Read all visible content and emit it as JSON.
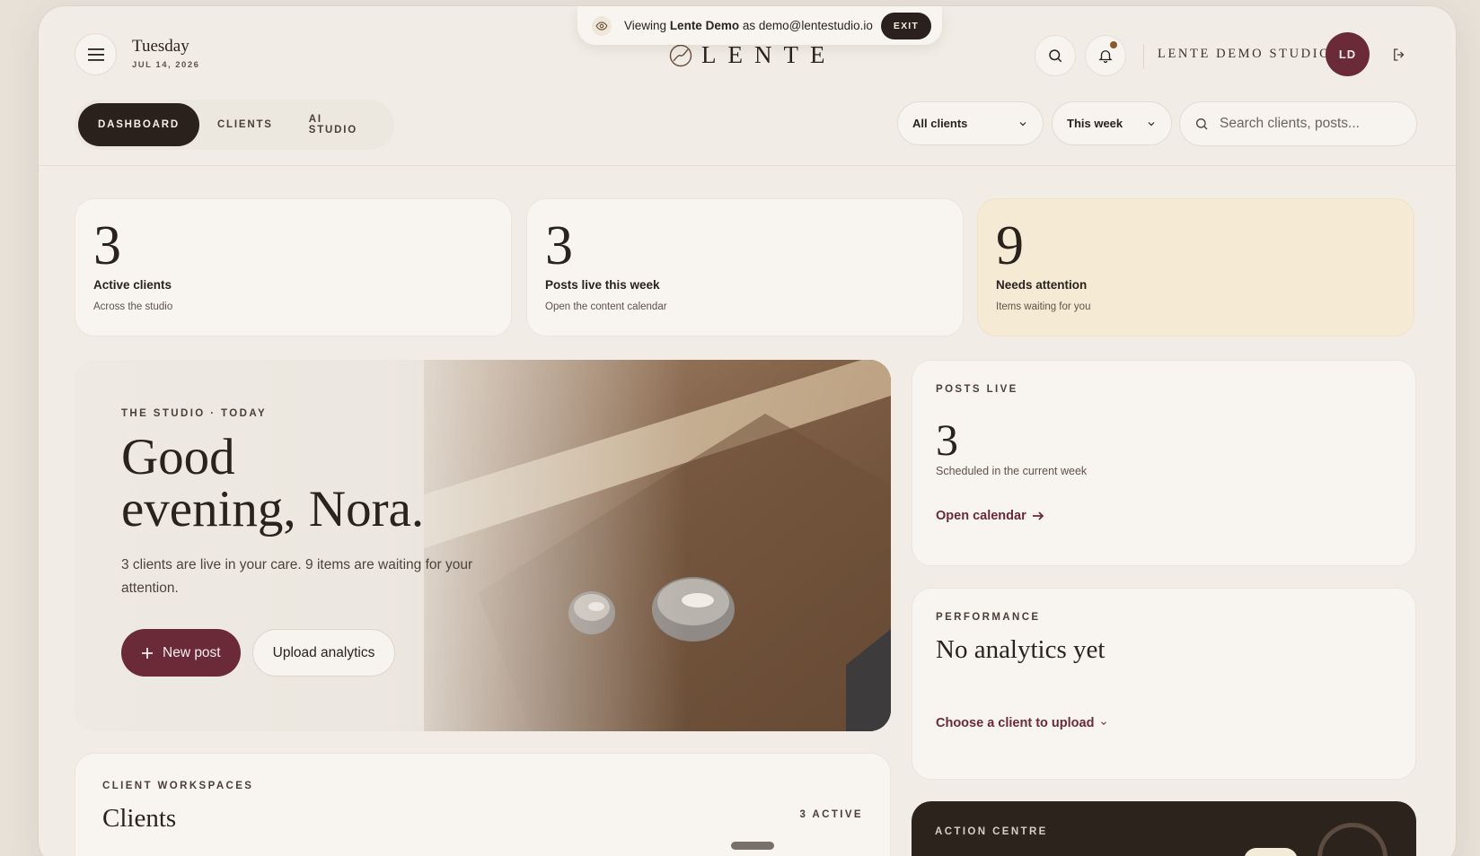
{
  "banner": {
    "prefix": "Viewing",
    "workspace": "Lente Demo",
    "middle": "as",
    "email": "demo@lentestudio.io",
    "exit_label": "EXIT"
  },
  "header": {
    "weekday": "Tuesday",
    "date": "JUL 14, 2026",
    "logo_text": "LENTE",
    "studio_name": "LENTE DEMO STUDIO",
    "avatar_initials": "LD"
  },
  "nav": {
    "tabs": [
      {
        "label": "DASHBOARD",
        "active": true
      },
      {
        "label": "CLIENTS",
        "active": false
      },
      {
        "label": "AI STUDIO",
        "active": false
      }
    ]
  },
  "filters": {
    "clients": "All clients",
    "period": "This week",
    "search_placeholder": "Search clients, posts..."
  },
  "stats": [
    {
      "value": "3",
      "label": "Active clients",
      "sub": "Across the studio"
    },
    {
      "value": "3",
      "label": "Posts live this week",
      "sub": "Open the content calendar"
    },
    {
      "value": "9",
      "label": "Needs attention",
      "sub": "Items waiting for you"
    }
  ],
  "hero": {
    "eyebrow": "THE STUDIO · TODAY",
    "title_line1": "Good",
    "title_line2": "evening, Nora.",
    "subtitle": "3 clients are live in your care. 9 items are waiting for your attention.",
    "primary_label": "New post",
    "secondary_label": "Upload analytics"
  },
  "posts_live": {
    "eyebrow": "POSTS LIVE",
    "value": "3",
    "sub": "Scheduled in the current week",
    "link": "Open calendar"
  },
  "performance": {
    "eyebrow": "PERFORMANCE",
    "title": "No analytics yet",
    "link": "Choose a client to upload"
  },
  "action_centre": {
    "eyebrow": "ACTION CENTRE"
  },
  "clients": {
    "eyebrow": "CLIENT WORKSPACES",
    "title": "Clients",
    "count": "3 ACTIVE"
  },
  "colors": {
    "accent": "#6a2a37",
    "dark": "#2b211c",
    "warn_card": "#f5ead4",
    "background": "#f1ede6"
  }
}
